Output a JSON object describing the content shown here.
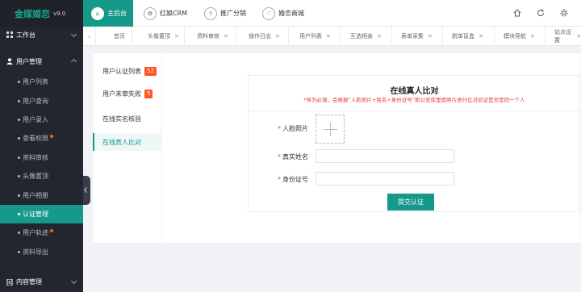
{
  "brand": {
    "name": "金媒婚恋",
    "version": "v9.0"
  },
  "header": {
    "tabs": [
      {
        "label": "主后台",
        "icon": "home-icon",
        "active": true
      },
      {
        "label": "红娘CRM",
        "icon": "crm-icon",
        "active": false
      },
      {
        "label": "推广分销",
        "icon": "share-icon",
        "active": false
      },
      {
        "label": "婚恋商城",
        "icon": "shop-icon",
        "active": false
      }
    ],
    "buttons": [
      "home-icon",
      "refresh-icon",
      "settings-icon"
    ]
  },
  "tabstrip": {
    "items": [
      {
        "label": "首页",
        "closable": false
      },
      {
        "label": "头像置顶",
        "closable": true
      },
      {
        "label": "资料审核",
        "closable": true
      },
      {
        "label": "操作日志",
        "closable": true
      },
      {
        "label": "用户列表",
        "closable": true
      },
      {
        "label": "互选相亲",
        "closable": true
      },
      {
        "label": "表单采集",
        "closable": true
      },
      {
        "label": "脱单盲盒",
        "closable": true
      },
      {
        "label": "模块导航",
        "closable": true
      },
      {
        "label": "站点设置",
        "closable": true
      }
    ]
  },
  "sidebar": {
    "groups": [
      {
        "label": "工作台",
        "expanded": false
      },
      {
        "label": "用户管理",
        "expanded": true
      },
      {
        "label": "内容管理",
        "expanded": false
      }
    ],
    "items": [
      {
        "label": "用户列表",
        "active": false,
        "dot": false
      },
      {
        "label": "用户查询",
        "active": false,
        "dot": false
      },
      {
        "label": "用户录入",
        "active": false,
        "dot": false
      },
      {
        "label": "查看权限",
        "active": false,
        "dot": true
      },
      {
        "label": "资料审核",
        "active": false,
        "dot": false
      },
      {
        "label": "头像置顶",
        "active": false,
        "dot": false
      },
      {
        "label": "用户相册",
        "active": false,
        "dot": false
      },
      {
        "label": "认证管理",
        "active": true,
        "dot": false
      },
      {
        "label": "用户轨迹",
        "active": false,
        "dot": true
      },
      {
        "label": "资料导出",
        "active": false,
        "dot": false
      }
    ]
  },
  "subnav": {
    "items": [
      {
        "label": "用户认证列表",
        "badge": "52",
        "active": false
      },
      {
        "label": "用户未审失败",
        "badge": "5",
        "active": false
      },
      {
        "label": "在线实名核验",
        "badge": "",
        "active": false
      },
      {
        "label": "在线真人比对",
        "badge": "",
        "active": true
      }
    ]
  },
  "form": {
    "title": "在线真人比对",
    "subtitle": "*导为必填，会根据“人脸照片+姓名+身份证号”和公安库里面照片进行比对验证是否是同一个人",
    "fields": {
      "photo": {
        "label": "人脸照片"
      },
      "name": {
        "label": "真实姓名",
        "value": ""
      },
      "idcard": {
        "label": "身份证号",
        "value": ""
      }
    },
    "submit_label": "提交认证"
  },
  "colors": {
    "accent": "#15998a",
    "sidebar": "#23262e",
    "badge": "#ff5722",
    "required": "#e4393c"
  }
}
